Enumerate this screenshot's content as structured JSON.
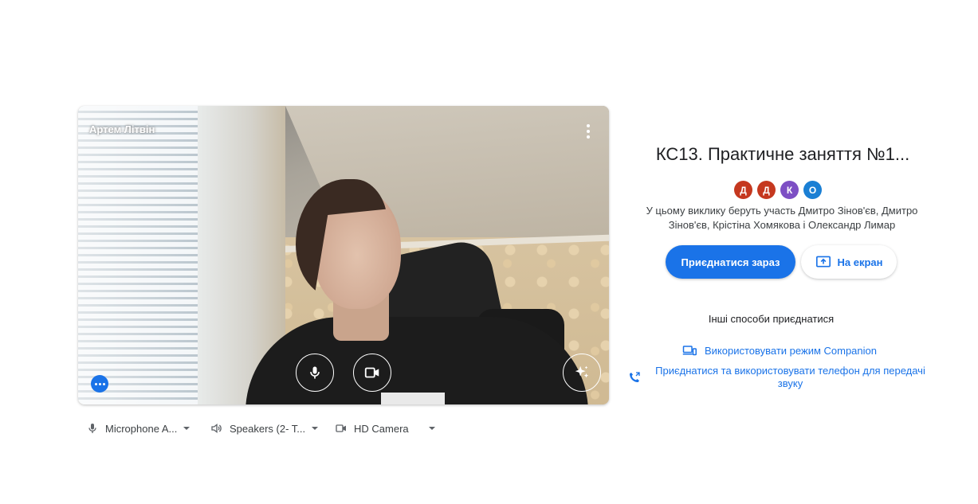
{
  "preview": {
    "participant_name": "Артем Літвін"
  },
  "devices": {
    "microphone": "Microphone A...",
    "speakers": "Speakers (2- T...",
    "camera": "HD Camera"
  },
  "meeting": {
    "title": "КС13. Практичне заняття №1...",
    "avatars": [
      {
        "letter": "Д",
        "color": "#c5381f"
      },
      {
        "letter": "Д",
        "color": "#c5381f"
      },
      {
        "letter": "К",
        "color": "#7d4fc4"
      },
      {
        "letter": "О",
        "color": "#1a7fd4"
      }
    ],
    "participants_text": "У цьому виклику беруть участь Дмитро Зінов'єв, Дмитро Зінов'єв, Крістіна Хомякова і Олександр Лимар",
    "join_label": "Приєднатися зараз",
    "present_label": "На екран",
    "other_ways": "Інші способи приєднатися",
    "companion_label": "Використовувати режим Companion",
    "phone_label": "Приєднатися та використовувати телефон для передачі звуку"
  },
  "colors": {
    "accent": "#1a73e8"
  }
}
